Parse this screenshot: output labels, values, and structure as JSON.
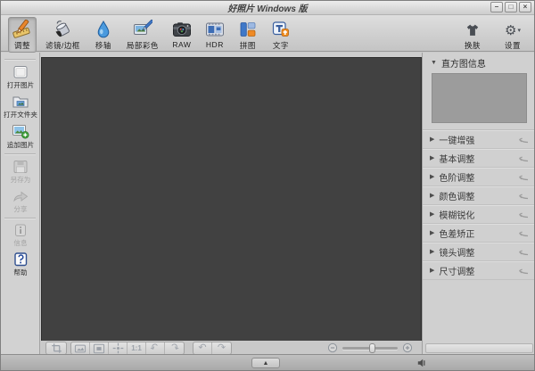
{
  "window": {
    "title": "好照片 Windows 版"
  },
  "glyphs": {
    "minimize": "–",
    "maximize": "□",
    "close": "×",
    "gear": "⚙",
    "dropdown": "▾",
    "expanded": "▼",
    "collapsed": "▶",
    "rotate_left": "↶",
    "rotate_right": "↷",
    "undo": "↶",
    "redo": "↷",
    "up": "▲"
  },
  "toolbar": {
    "tools": [
      {
        "label": "调整",
        "active": true
      },
      {
        "label": "滤镜/边框",
        "active": false
      },
      {
        "label": "移轴",
        "active": false
      },
      {
        "label": "局部彩色",
        "active": false
      },
      {
        "label": "RAW",
        "active": false
      },
      {
        "label": "HDR",
        "active": false
      },
      {
        "label": "拼图",
        "active": false
      },
      {
        "label": "文字",
        "active": false
      }
    ],
    "right": [
      {
        "label": "换肤"
      },
      {
        "label": "设置"
      }
    ]
  },
  "sidebar": {
    "items": [
      {
        "label": "打开图片",
        "enabled": true
      },
      {
        "label": "打开文件夹",
        "enabled": true
      },
      {
        "label": "追加图片",
        "enabled": true
      },
      {
        "label": "另存为",
        "enabled": false
      },
      {
        "label": "分享",
        "enabled": false
      },
      {
        "label": "信息",
        "enabled": false
      },
      {
        "label": "帮助",
        "enabled": true
      }
    ]
  },
  "canvas_toolbar": {
    "ratio_label": "1:1",
    "zoom_slider_fraction": 0.5
  },
  "right_panel": {
    "histogram_label": "直方图信息",
    "sections": [
      {
        "label": "一键增强"
      },
      {
        "label": "基本调整"
      },
      {
        "label": "色阶调整"
      },
      {
        "label": "颜色调整"
      },
      {
        "label": "模糊锐化"
      },
      {
        "label": "色差矫正"
      },
      {
        "label": "镜头调整"
      },
      {
        "label": "尺寸调整"
      }
    ]
  }
}
